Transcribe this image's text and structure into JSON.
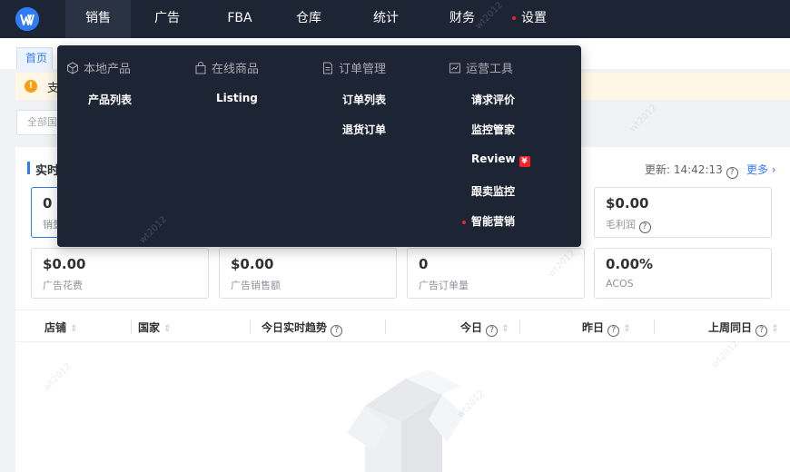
{
  "nav": {
    "items": [
      "销售",
      "广告",
      "FBA",
      "仓库",
      "统计",
      "财务",
      "设置"
    ]
  },
  "tabs": {
    "home": "首页"
  },
  "notice": {
    "text": "支"
  },
  "filter": {
    "placeholder": "全部国"
  },
  "realtime": {
    "title": "实时",
    "update_label": "更新: 14:42:13",
    "more": "更多 ›"
  },
  "cards": [
    {
      "value": "0",
      "label": "销量"
    },
    {
      "value": "$0.00",
      "label": "毛利润"
    },
    {
      "value": "$0.00",
      "label": "广告花费"
    },
    {
      "value": "$0.00",
      "label": "广告销售额"
    },
    {
      "value": "0",
      "label": "广告订单量"
    },
    {
      "value": "0.00%",
      "label": "ACOS"
    }
  ],
  "table": {
    "columns": [
      "店铺",
      "国家",
      "今日实时趋势",
      "今日",
      "昨日",
      "上周同日"
    ]
  },
  "dropdown": {
    "columns": [
      {
        "title": "本地产品",
        "icon": "cube-icon",
        "items": [
          "产品列表"
        ]
      },
      {
        "title": "在线商品",
        "icon": "bag-icon",
        "items": [
          "Listing"
        ]
      },
      {
        "title": "订单管理",
        "icon": "document-icon",
        "items": [
          "订单列表",
          "退货订单"
        ]
      },
      {
        "title": "运营工具",
        "icon": "chart-icon",
        "items": [
          "请求评价",
          "监控管家",
          "Review",
          "跟卖监控",
          "智能营销"
        ]
      }
    ],
    "badge": "¥"
  },
  "watermark": "wt2012",
  "colors": {
    "topbar": "#1d2433",
    "accent": "#2f7cf6",
    "red": "#f5222d"
  }
}
